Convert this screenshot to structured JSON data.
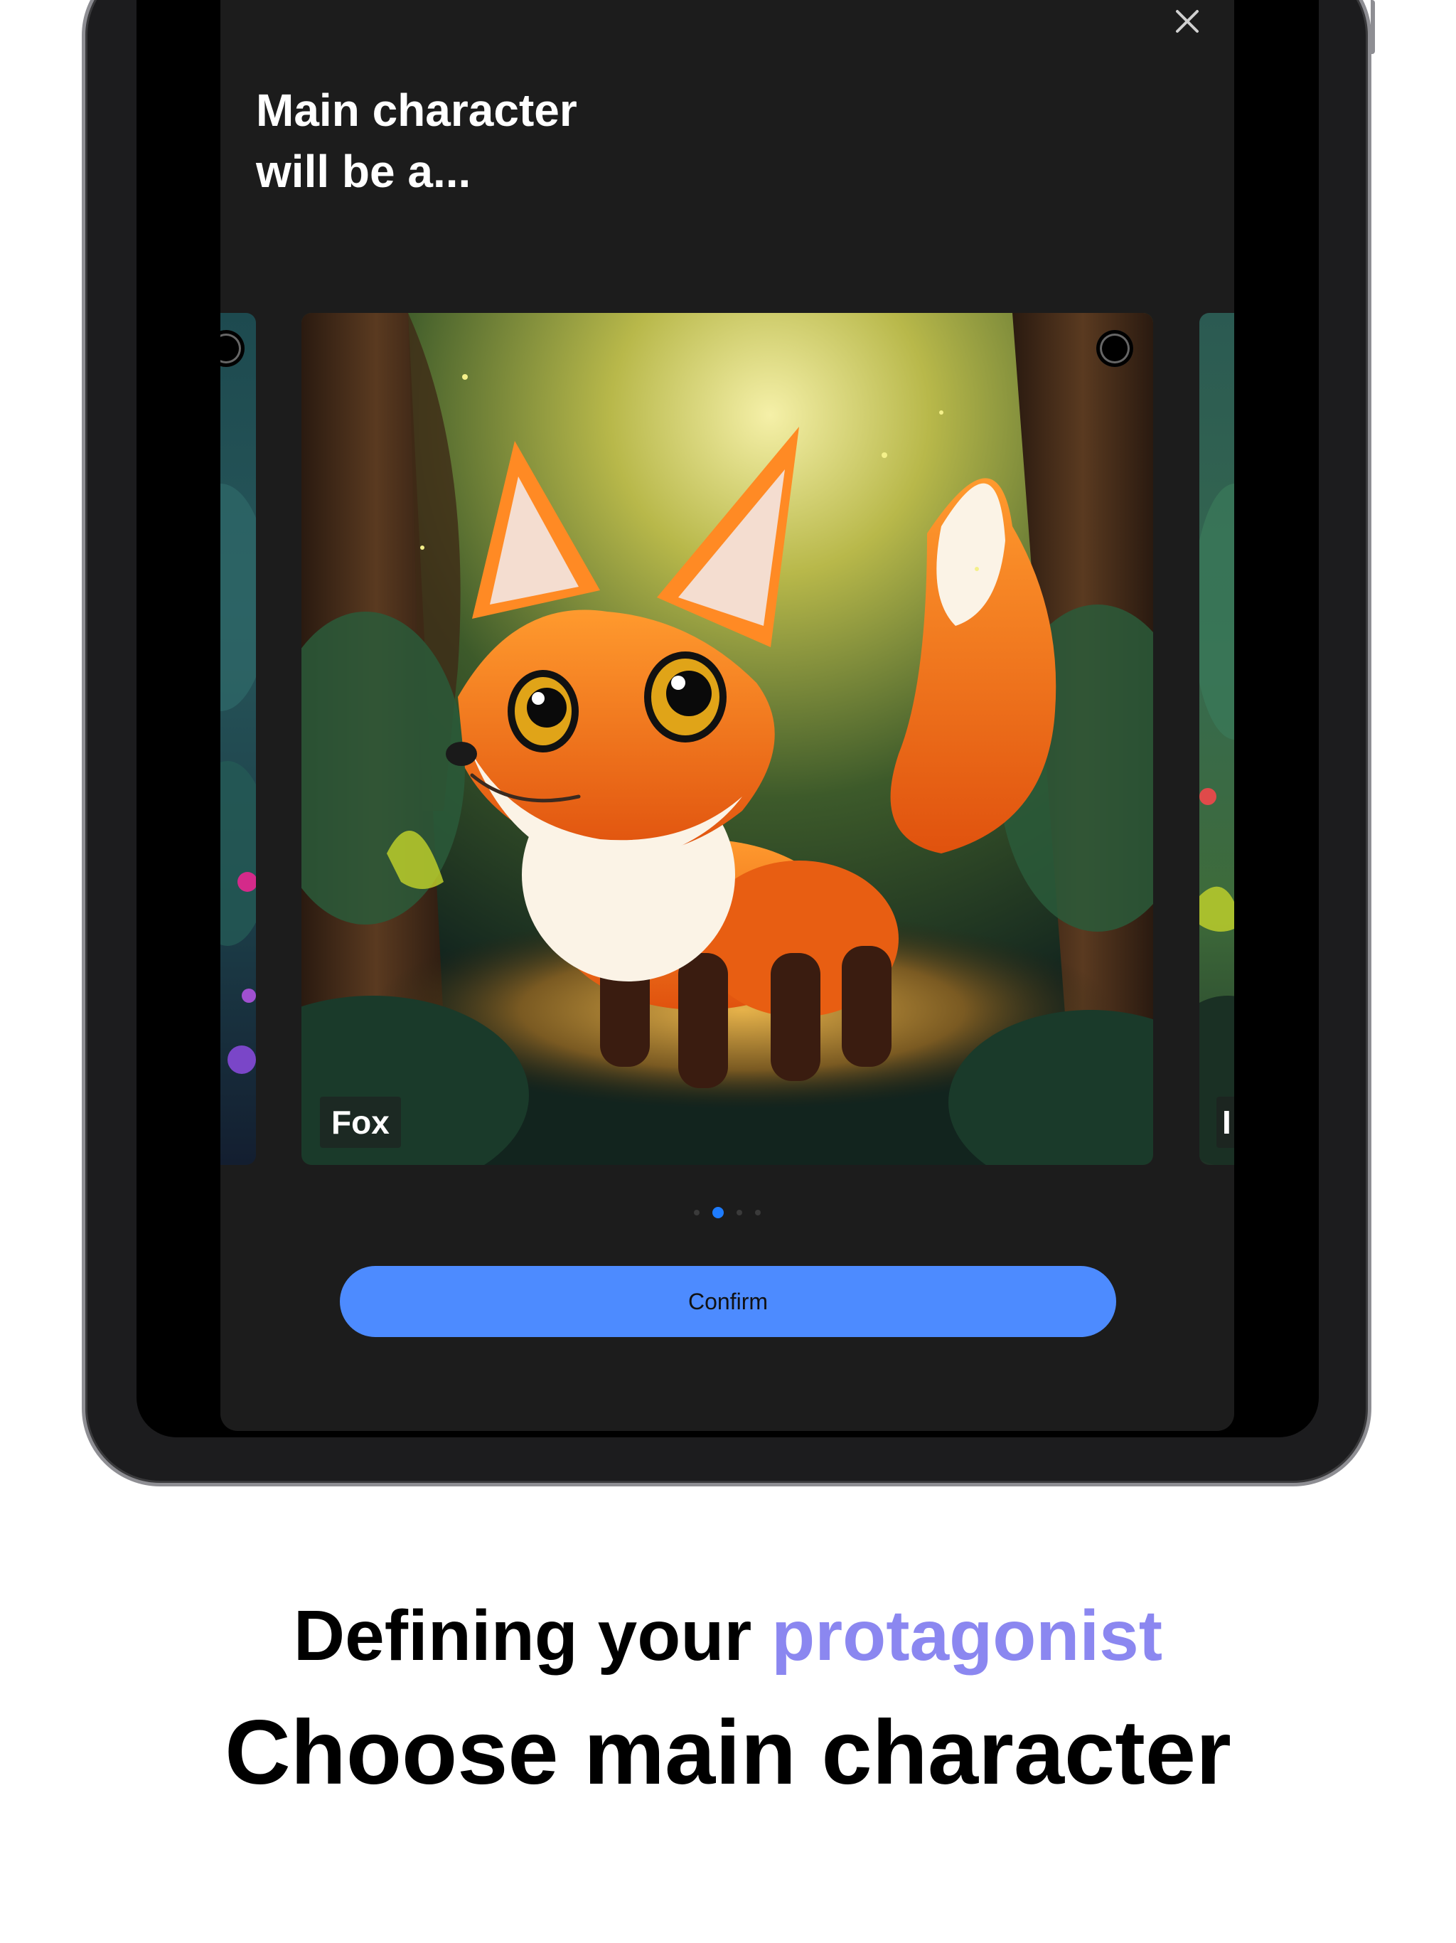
{
  "sheet": {
    "title": "Main character\nwill be a...",
    "close_icon": "close-icon"
  },
  "carousel": {
    "selected_index": 1,
    "cards": [
      {
        "label": "",
        "icon": "forest-illustration"
      },
      {
        "label": "Fox",
        "icon": "fox-illustration"
      },
      {
        "label": "I",
        "icon": "forest-illustration"
      }
    ],
    "page_count": 4,
    "active_page": 1
  },
  "actions": {
    "confirm_label": "Confirm"
  },
  "caption": {
    "subtitle_prefix": "Defining your ",
    "subtitle_accent": "protagonist",
    "title": "Choose main character"
  },
  "colors": {
    "accent_text": "#8b87f0",
    "confirm_button": "#4d8bff",
    "active_dot": "#1e7cff",
    "sheet_background": "#1c1c1c"
  }
}
